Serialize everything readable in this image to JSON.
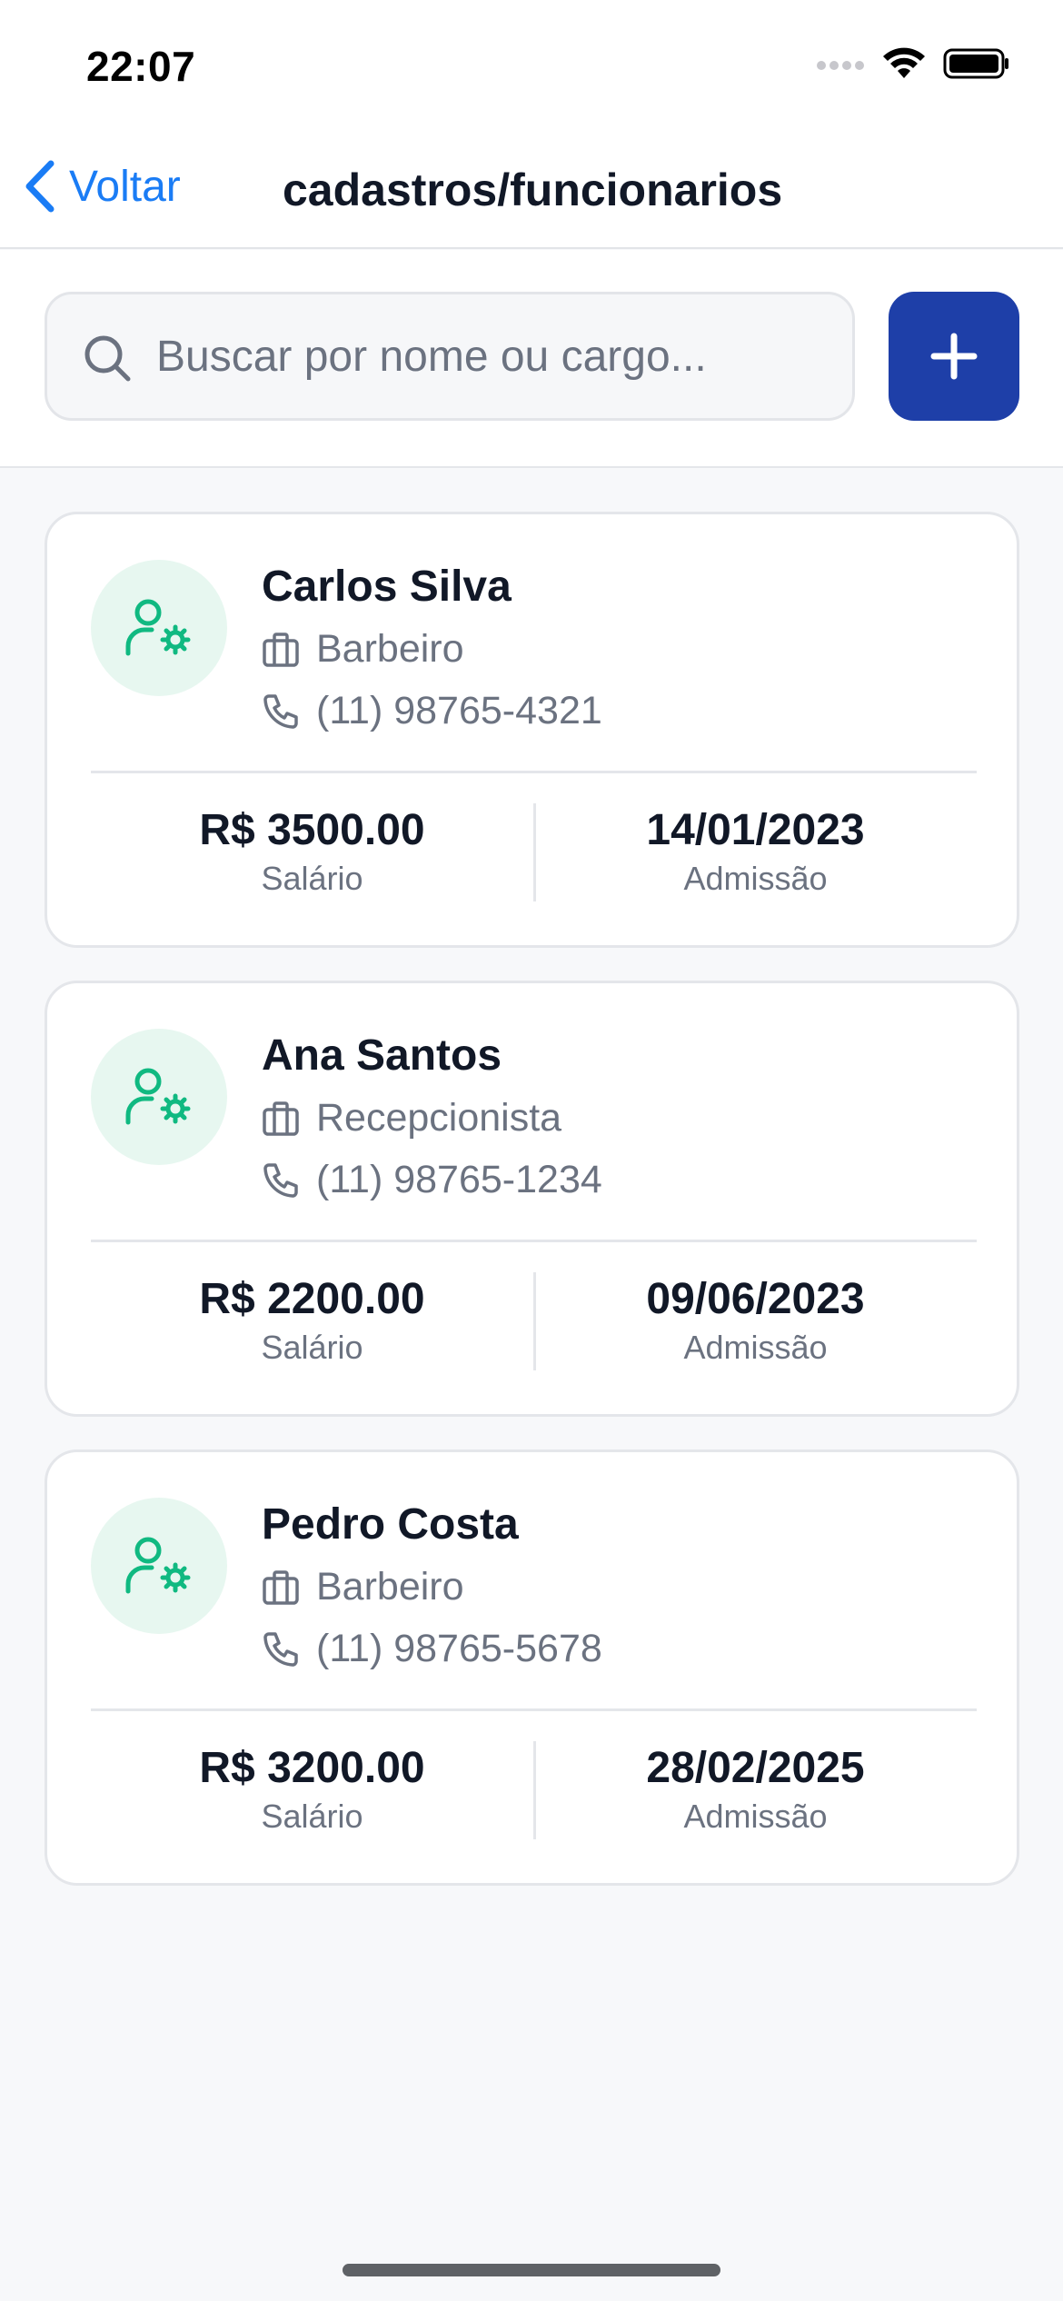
{
  "status_bar": {
    "time": "22:07"
  },
  "nav": {
    "back_label": "Voltar",
    "title": "cadastros/funcionarios"
  },
  "search": {
    "placeholder": "Buscar por nome ou cargo...",
    "value": ""
  },
  "add_button": {
    "icon": "plus-icon"
  },
  "employees": [
    {
      "name": "Carlos Silva",
      "role": "Barbeiro",
      "phone": "(11) 98765-4321",
      "salary": "R$ 3500.00",
      "salary_label": "Salário",
      "admission": "14/01/2023",
      "admission_label": "Admissão"
    },
    {
      "name": "Ana Santos",
      "role": "Recepcionista",
      "phone": "(11) 98765-1234",
      "salary": "R$ 2200.00",
      "salary_label": "Salário",
      "admission": "09/06/2023",
      "admission_label": "Admissão"
    },
    {
      "name": "Pedro Costa",
      "role": "Barbeiro",
      "phone": "(11) 98765-5678",
      "salary": "R$ 3200.00",
      "salary_label": "Salário",
      "admission": "28/02/2025",
      "admission_label": "Admissão"
    }
  ],
  "colors": {
    "accent": "#1a7cf5",
    "primary_button": "#1e3fa8",
    "avatar_bg": "#e7f7f0",
    "avatar_icon": "#10b981"
  }
}
